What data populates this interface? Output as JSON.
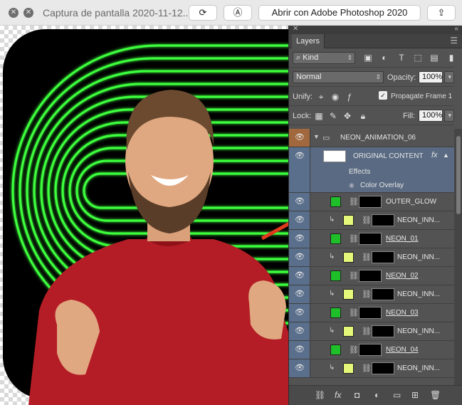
{
  "window": {
    "title": "Captura de pantalla 2020-11-12...",
    "open_with": "Abrir con Adobe Photoshop 2020"
  },
  "panel": {
    "tab": "Layers",
    "kind_label": "Kind",
    "blend_mode": "Normal",
    "opacity_label": "Opacity:",
    "opacity_value": "100%",
    "unify_label": "Unify:",
    "propagate_label": "Propagate Frame 1",
    "lock_label": "Lock:",
    "fill_label": "Fill:",
    "fill_value": "100%"
  },
  "layers": [
    {
      "name": "NEON_ANIMATION_06",
      "type": "group"
    },
    {
      "name": "ORIGINAL CONTENT",
      "type": "smart",
      "selected": true
    },
    {
      "name": "Effects",
      "type": "effects-header"
    },
    {
      "name": "Color Overlay",
      "type": "effect"
    },
    {
      "name": "OUTER_GLOW",
      "type": "layer",
      "swatch": "#1fbf2a",
      "clip": false
    },
    {
      "name": "NEON_INN...",
      "type": "layer",
      "swatch": "#e6f87a",
      "clip": true
    },
    {
      "name": "NEON_01",
      "type": "layer",
      "swatch": "#1fbf2a",
      "clip": false,
      "underline": true
    },
    {
      "name": "NEON_INN...",
      "type": "layer",
      "swatch": "#e6f87a",
      "clip": true
    },
    {
      "name": "NEON_02",
      "type": "layer",
      "swatch": "#1fbf2a",
      "clip": false,
      "underline": true
    },
    {
      "name": "NEON_INN...",
      "type": "layer",
      "swatch": "#e6f87a",
      "clip": true
    },
    {
      "name": "NEON_03",
      "type": "layer",
      "swatch": "#1fbf2a",
      "clip": false,
      "underline": true
    },
    {
      "name": "NEON_INN...",
      "type": "layer",
      "swatch": "#e6f87a",
      "clip": true
    },
    {
      "name": "NEON_04",
      "type": "layer",
      "swatch": "#1fbf2a",
      "clip": false,
      "underline": true
    },
    {
      "name": "NEON_INN...",
      "type": "layer",
      "swatch": "#e6f87a",
      "clip": true
    }
  ],
  "colors": {
    "neon": "#39ff3a",
    "sweater": "#b51d26",
    "panel_bg": "#535353",
    "selected": "#596a82",
    "group_eye": "#a0683c",
    "arrow": "#e03a1c"
  }
}
